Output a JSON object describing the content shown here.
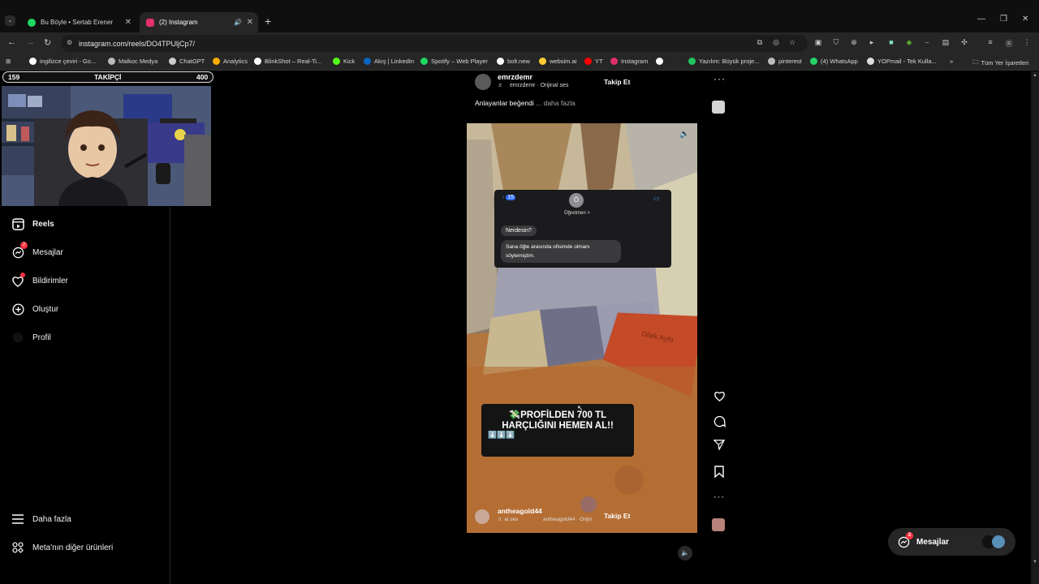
{
  "browser": {
    "tabs": [
      {
        "title": "Bu Böyle • Sertab Erener",
        "favicon_color": "#1ed760",
        "active": false
      },
      {
        "title": "(2) Instagram",
        "favicon_color": "#e1306c",
        "active": true
      }
    ],
    "url": "instagram.com/reels/DO4TPUljCp7/",
    "bookmarks": [
      {
        "label": "ingilizce çeviri - Go...",
        "icon_color": "#ffffff"
      },
      {
        "label": "Malkoc Medya",
        "icon_color": "#bbbbbb"
      },
      {
        "label": "ChatGPT",
        "icon_color": "#cccccc"
      },
      {
        "label": "Analytics",
        "icon_color": "#f9ab00"
      },
      {
        "label": "BlinkShot – Real-Ti...",
        "icon_color": "#ffffff"
      },
      {
        "label": "Kick",
        "icon_color": "#53fc18"
      },
      {
        "label": "Akış | LinkedIn",
        "icon_color": "#0a66c2"
      },
      {
        "label": "Spotify – Web Player",
        "icon_color": "#1ed760"
      },
      {
        "label": "bolt.new",
        "icon_color": "#ffffff"
      },
      {
        "label": "websim.ai",
        "icon_color": "#ffcc33"
      },
      {
        "label": "YT",
        "icon_color": "#ff0000"
      },
      {
        "label": "Instagram",
        "icon_color": "#e1306c"
      },
      {
        "label": "",
        "icon_color": "#ffffff"
      },
      {
        "label": "Yazılım: Büyük proje...",
        "icon_color": "#21c45d"
      },
      {
        "label": "pinterest",
        "icon_color": "#bbbbbb"
      },
      {
        "label": "(4) WhatsApp",
        "icon_color": "#25d366"
      },
      {
        "label": "YOPmail - Tek Kulla...",
        "icon_color": "#dddddd"
      }
    ],
    "all_bookmarks_label": "Tüm Yer İşaretleri"
  },
  "overlay": {
    "follower_current": "159",
    "follower_label": "TAKİPÇİ",
    "follower_goal": "400"
  },
  "sidebar": {
    "items": [
      {
        "label": "Reels",
        "icon": "reels-icon",
        "bold": true
      },
      {
        "label": "Mesajlar",
        "icon": "messenger-icon",
        "badge": "2"
      },
      {
        "label": "Bildirimler",
        "icon": "heart-icon"
      },
      {
        "label": "Oluştur",
        "icon": "plus-square-icon"
      },
      {
        "label": "Profil",
        "icon": "avatar-icon"
      }
    ],
    "bottom": [
      {
        "label": "Daha fazla",
        "icon": "hamburger-icon"
      },
      {
        "label": "Meta'nın diğer ürünleri",
        "icon": "grid-icon"
      }
    ]
  },
  "reel_top": {
    "username": "emrzdemr",
    "audio": "emrzdemr · Orijinal ses",
    "follow_label": "Takip Et",
    "caption": "Anlayanlar beğendi",
    "more_label": "... daha fazla"
  },
  "reel_video": {
    "chat_badge": "15",
    "chat_avatar_letter": "Ö",
    "chat_contact": "Öğretmen >",
    "chat_msg1": "Nerdesin?",
    "chat_msg2": "Sana öğle arasında ofisimde olmanı söylemiştim.",
    "promo_line1": "💸PROFİLDEN 700 TL",
    "promo_line2": "HARÇLIĞINI HEMEN AL!!",
    "promo_arrows": "⬇️⬇️⬇️",
    "bottom_username": "antheagold44",
    "bottom_audio": "♬ al ses",
    "bottom_audio2": "antheagold44 · Orijin",
    "bottom_follow": "Takip Et",
    "sign_text": "Dilek Ayfo"
  },
  "messages_pill": {
    "label": "Mesajlar",
    "badge": "2"
  }
}
